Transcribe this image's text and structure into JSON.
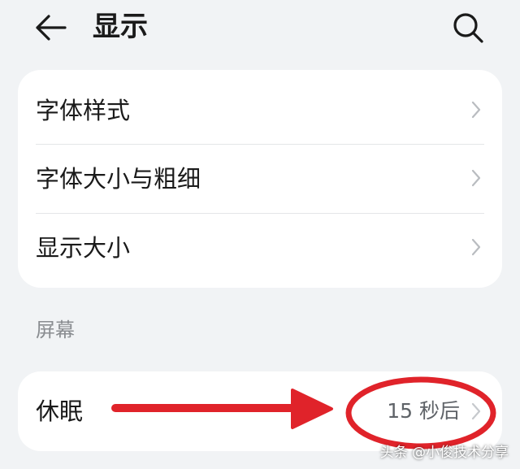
{
  "header": {
    "title": "显示",
    "back_icon": "arrow-left-icon",
    "search_icon": "search-icon"
  },
  "font_card": {
    "items": [
      {
        "label": "字体样式"
      },
      {
        "label": "字体大小与粗细"
      },
      {
        "label": "显示大小"
      }
    ]
  },
  "screen_section": {
    "title": "屏幕",
    "sleep": {
      "label": "休眠",
      "value": "15 秒后"
    }
  },
  "annotation": {
    "color": "#e0232a"
  },
  "watermark": {
    "text": "头条 @小俊技术分享"
  }
}
